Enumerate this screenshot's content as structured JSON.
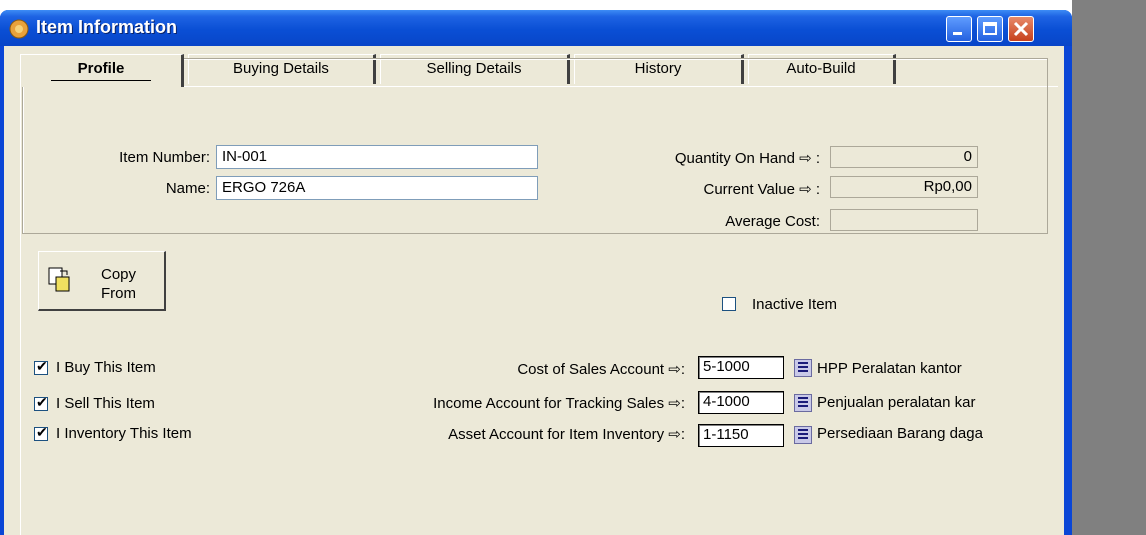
{
  "window": {
    "title": "Item Information"
  },
  "tabs": [
    {
      "label": "Profile"
    },
    {
      "label": "Buying Details"
    },
    {
      "label": "Selling Details"
    },
    {
      "label": "History"
    },
    {
      "label": "Auto-Build"
    }
  ],
  "profile": {
    "item_number_label": "Item Number:",
    "item_number_value": "IN-001",
    "name_label": "Name:",
    "name_value": "ERGO 726A",
    "qty_label": "Quantity On Hand ⇨ :",
    "qty_value": "0",
    "current_value_label": "Current Value ⇨ :",
    "current_value": "Rp0,00",
    "avg_cost_label": "Average Cost:",
    "avg_cost_value": "",
    "copy_from_line1": "Copy",
    "copy_from_line2": "From",
    "inactive_label": "Inactive Item",
    "inactive_checked": false
  },
  "options": [
    {
      "label": "I Buy This Item",
      "checked": true
    },
    {
      "label": "I Sell This Item",
      "checked": true
    },
    {
      "label": "I Inventory This Item",
      "checked": true
    }
  ],
  "accounts": [
    {
      "label": "Cost of Sales Account ⇨:",
      "code": "5-1000",
      "name": "HPP Peralatan kantor"
    },
    {
      "label": "Income Account for Tracking Sales ⇨:",
      "code": "4-1000",
      "name": "Penjualan peralatan kar"
    },
    {
      "label": "Asset Account for Item Inventory ⇨:",
      "code": "1-1150",
      "name": "Persediaan Barang daga"
    }
  ],
  "colors": {
    "titlebar": "#0a4fd5",
    "face": "#ece9d8"
  }
}
